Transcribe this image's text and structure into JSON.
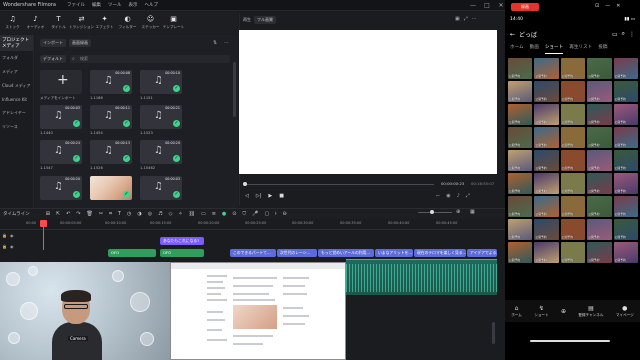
{
  "app": {
    "title": "Wondershare Filmora",
    "menu": [
      "ファイル",
      "編集",
      "ツール",
      "表示",
      "ヘルプ"
    ]
  },
  "toolbar": [
    {
      "icon": "music-icon",
      "label": "ストック"
    },
    {
      "icon": "audio-icon",
      "label": "オーディオ"
    },
    {
      "icon": "text-icon",
      "label": "タイトル"
    },
    {
      "icon": "transition-icon",
      "label": "トランジション"
    },
    {
      "icon": "effects-icon",
      "label": "エフェクト"
    },
    {
      "icon": "filter-icon",
      "label": "フィルター"
    },
    {
      "icon": "sticker-icon",
      "label": "ステッカー"
    },
    {
      "icon": "template-icon",
      "label": "テンプレート"
    }
  ],
  "leftnav": {
    "header": "プロジェクトメディア",
    "items": [
      "フォルダ",
      "メディア",
      "Cloud メディア",
      "Influence Kit",
      "アドレイヤー",
      "リソース"
    ]
  },
  "media": {
    "import_dropdown": "インポート",
    "record_dropdown": "画面録画",
    "folder_dropdown": "デフォルト",
    "search_placeholder": "検索",
    "import_label": "メディアをインポート",
    "tiles": [
      {
        "dur": "00:00:08",
        "label": "1-1166"
      },
      {
        "dur": "00:00:10",
        "label": "1-1151"
      },
      {
        "dur": "00:00:03",
        "label": "1-1440"
      },
      {
        "dur": "00:00:11",
        "label": "1-1454"
      },
      {
        "dur": "00:00:21",
        "label": "1-1523"
      },
      {
        "dur": "00:00:24",
        "label": "1-1547"
      },
      {
        "dur": "00:00:13",
        "label": "1-1526"
      },
      {
        "dur": "00:00:20",
        "label": "1-10462"
      },
      {
        "dur": "00:00:20",
        "label": ""
      },
      {
        "dur": "",
        "label": ""
      },
      {
        "dur": "00:00:03",
        "label": ""
      }
    ]
  },
  "preview": {
    "mode": "再生",
    "quality": "フル画質",
    "timecode": "00:00:00:23",
    "duration": "00:16:55:07"
  },
  "timeline": {
    "label": "タイムライン",
    "ruler": [
      "00:00",
      "00:00:05:00",
      "00:00:10:00",
      "00:00:15:00",
      "00:00:20:00",
      "00:00:25:00",
      "00:00:30:00",
      "00:00:35:00",
      "00:00:40:00",
      "00:00:45:00"
    ],
    "title_clip": "あなたもこれになる?",
    "green_clips": [
      "OFO",
      "OFO"
    ],
    "blue_clips": [
      "このできるパートて...",
      "次世代のレーシ...",
      "もっと覚めいアールの利用...",
      "いまなアリットを...",
      "現在のテロマを楽しく見る...",
      "アイデアでよる..."
    ]
  },
  "webcam": {
    "label": "Camera"
  },
  "phone": {
    "status_time": "14:40",
    "top_button": "録画",
    "channel": "どっば",
    "tabs": [
      "ホーム",
      "動画",
      "ショート",
      "再生リスト",
      "投稿"
    ],
    "active_tab": "ショート",
    "cells": [
      "公開予約",
      "公開予約",
      "公開予約",
      "公開予約",
      "公開予約",
      "公開予約",
      "公開予約",
      "公開予約",
      "公開予約",
      "公開予約",
      "公開予約",
      "公開予約",
      "公開予約",
      "公開予約",
      "公開予約",
      "公開予約",
      "公開予約",
      "公開予約",
      "公開予約",
      "公開予約",
      "公開予約",
      "公開予約",
      "公開予約",
      "公開予約",
      "公開予約",
      "公開予約",
      "公開予約",
      "公開予約",
      "公開予約",
      "公開予約",
      "公開予約",
      "公開予約",
      "公開予約",
      "公開予約",
      "公開予約",
      "公開予約",
      "公開予約",
      "公開予約",
      "公開予約",
      "公開予約",
      "公開予約",
      "公開予約",
      "公開予約",
      "公開予約",
      "公開予約"
    ],
    "nav": [
      "ホーム",
      "ショート",
      "",
      "登録チャンネル",
      "マイページ"
    ]
  }
}
